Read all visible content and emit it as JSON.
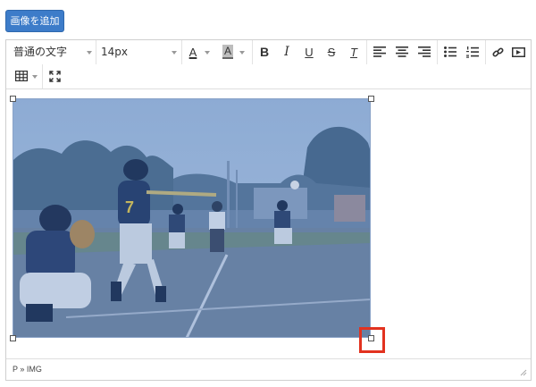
{
  "add_image_button": "画像を追加",
  "toolbar": {
    "block_format": "普通の文字",
    "font_size": "14px",
    "icons": [
      "text-color-icon",
      "background-color-icon",
      "bold-icon",
      "italic-icon",
      "underline-icon",
      "strikethrough-icon",
      "clear-format-icon",
      "align-left-icon",
      "align-center-icon",
      "align-right-icon",
      "bullet-list-icon",
      "numbered-list-icon",
      "link-icon",
      "media-icon",
      "table-icon",
      "fullscreen-icon"
    ],
    "text_color_letter": "A",
    "bg_color_letter": "A",
    "bold_letter": "B",
    "italic_letter": "I",
    "underline_letter": "U",
    "strike_letter": "S",
    "clear_format_letter": "T"
  },
  "content": {
    "image": {
      "description_icon": "baseball-photo",
      "jersey_number": "7",
      "selected": true
    }
  },
  "statusbar": {
    "path": "P » IMG"
  },
  "colors": {
    "button": "#3d7cc9",
    "highlight": "#e2321f",
    "selection_tint": "#3d6fb0"
  }
}
